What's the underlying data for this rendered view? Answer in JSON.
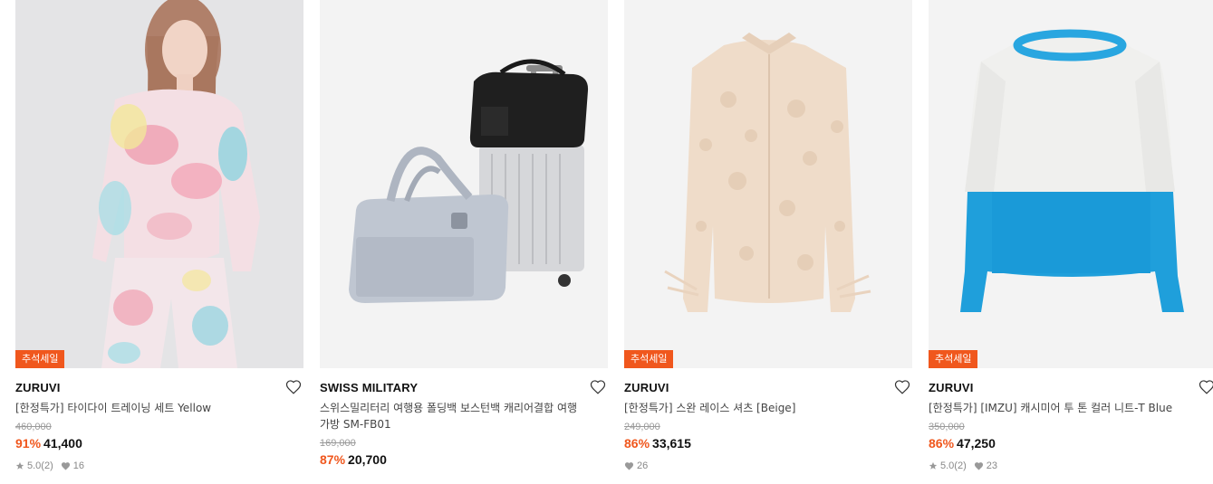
{
  "products": [
    {
      "badge": "추석세일",
      "brand": "ZURUVI",
      "title": "[한정특가] 타이다이 트레이닝 세트 Yellow",
      "original_price": "460,000",
      "discount": "91%",
      "price": "41,400",
      "rating": "5.0",
      "review_count": "(2)",
      "likes": "16"
    },
    {
      "badge": "",
      "brand": "SWISS MILITARY",
      "title": "스위스밀리터리 여행용 폴딩백 보스턴백 캐리어결합 여행가방 SM-FB01",
      "original_price": "169,000",
      "discount": "87%",
      "price": "20,700",
      "rating": "",
      "review_count": "",
      "likes": ""
    },
    {
      "badge": "추석세일",
      "brand": "ZURUVI",
      "title": "[한정특가] 스완 레이스 셔츠 [Beige]",
      "original_price": "249,000",
      "discount": "86%",
      "price": "33,615",
      "rating": "",
      "review_count": "",
      "likes": "26"
    },
    {
      "badge": "추석세일",
      "brand": "ZURUVI",
      "title": "[한정특가] [IMZU] 캐시미어 투 톤 컬러 니트-T Blue",
      "original_price": "350,000",
      "discount": "86%",
      "price": "47,250",
      "rating": "5.0",
      "review_count": "(2)",
      "likes": "23"
    }
  ],
  "icons": {
    "wishlist": "heart-outline-icon",
    "rating": "star-icon",
    "likes": "heart-filled-icon"
  },
  "colors": {
    "accent": "#f0571d",
    "image_bg": "#f3f3f3"
  }
}
